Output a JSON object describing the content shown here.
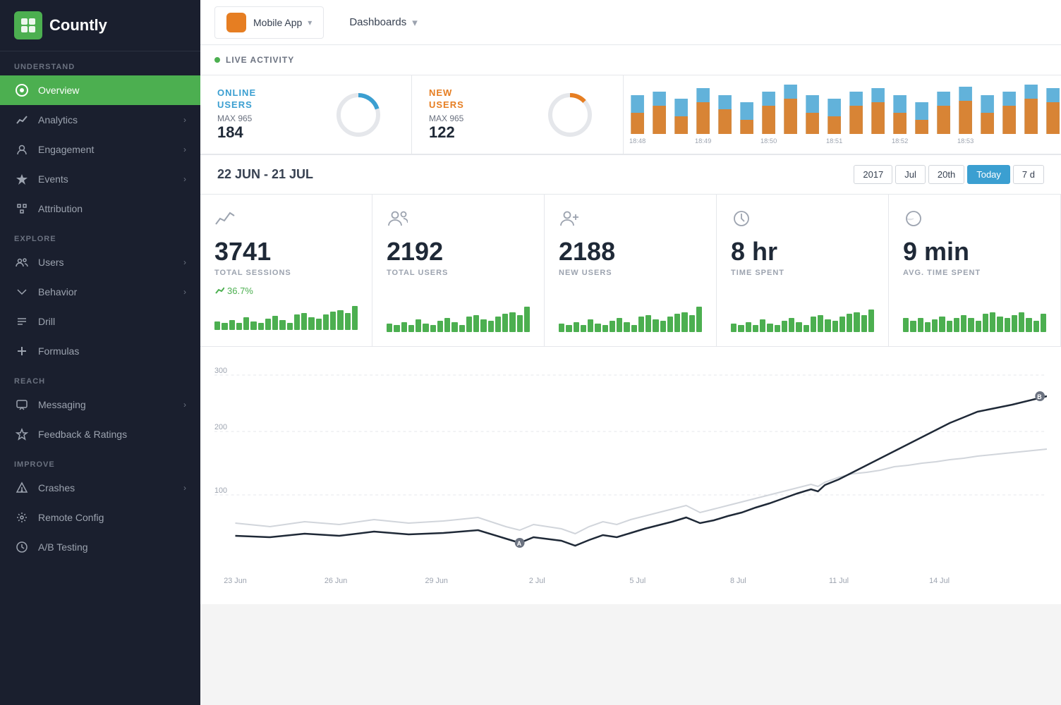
{
  "app": {
    "logo_text": "Countly",
    "logo_icon": "C"
  },
  "topbar": {
    "app_name": "Mobile App",
    "app_arrow": "▾",
    "dashboards_label": "Dashboards",
    "dashboards_arrow": "▾"
  },
  "sidebar": {
    "sections": [
      {
        "label": "UNDERSTAND",
        "items": [
          {
            "id": "overview",
            "label": "Overview",
            "icon": "⊙",
            "active": true,
            "has_arrow": false
          },
          {
            "id": "analytics",
            "label": "Analytics",
            "icon": "📈",
            "active": false,
            "has_arrow": true
          },
          {
            "id": "engagement",
            "label": "Engagement",
            "icon": "😊",
            "active": false,
            "has_arrow": true
          },
          {
            "id": "events",
            "label": "Events",
            "icon": "◆",
            "active": false,
            "has_arrow": true
          },
          {
            "id": "attribution",
            "label": "Attribution",
            "icon": "🏷",
            "active": false,
            "has_arrow": false
          }
        ]
      },
      {
        "label": "EXPLORE",
        "items": [
          {
            "id": "users",
            "label": "Users",
            "icon": "👥",
            "active": false,
            "has_arrow": true
          },
          {
            "id": "behavior",
            "label": "Behavior",
            "icon": "▼",
            "active": false,
            "has_arrow": true
          },
          {
            "id": "drill",
            "label": "Drill",
            "icon": "⚖",
            "active": false,
            "has_arrow": false
          },
          {
            "id": "formulas",
            "label": "Formulas",
            "icon": "➕",
            "active": false,
            "has_arrow": false
          }
        ]
      },
      {
        "label": "REACH",
        "items": [
          {
            "id": "messaging",
            "label": "Messaging",
            "icon": "💬",
            "active": false,
            "has_arrow": true
          },
          {
            "id": "feedback",
            "label": "Feedback & Ratings",
            "icon": "⭐",
            "active": false,
            "has_arrow": false
          }
        ]
      },
      {
        "label": "IMPROVE",
        "items": [
          {
            "id": "crashes",
            "label": "Crashes",
            "icon": "⚠",
            "active": false,
            "has_arrow": true
          },
          {
            "id": "remote-config",
            "label": "Remote Config",
            "icon": "⚙",
            "active": false,
            "has_arrow": false
          },
          {
            "id": "ab-testing",
            "label": "A/B Testing",
            "icon": "🔬",
            "active": false,
            "has_arrow": false
          }
        ]
      }
    ]
  },
  "live_activity": {
    "label": "LIVE ACTIVITY",
    "online_users": {
      "title_line1": "ONLINE",
      "title_line2": "USERS",
      "max_label": "MAX 965",
      "value": "184",
      "percent": 19
    },
    "new_users": {
      "title_line1": "NEW",
      "title_line2": "USERS",
      "max_label": "MAX 965",
      "value": "122",
      "percent": 13
    }
  },
  "date_range": {
    "label": "22 JUN - 21 JUL",
    "filters": [
      "2017",
      "Jul",
      "20th",
      "Today",
      "7 d"
    ]
  },
  "stats": [
    {
      "icon": "📈",
      "value": "3741",
      "label": "TOTAL SESSIONS",
      "trend": "36.7%",
      "bars": [
        3,
        2,
        3,
        2,
        4,
        3,
        2,
        3,
        4,
        3,
        2,
        4,
        5,
        4,
        3,
        4,
        5,
        6,
        5,
        7
      ]
    },
    {
      "icon": "👥",
      "value": "2192",
      "label": "TOTAL USERS",
      "trend": null,
      "bars": [
        3,
        2,
        3,
        2,
        4,
        3,
        2,
        3,
        4,
        3,
        2,
        4,
        5,
        4,
        3,
        4,
        5,
        6,
        5,
        8
      ]
    },
    {
      "icon": "👤+",
      "value": "2188",
      "label": "NEW USERS",
      "trend": null,
      "bars": [
        3,
        2,
        3,
        2,
        4,
        3,
        2,
        3,
        4,
        3,
        2,
        4,
        5,
        4,
        3,
        4,
        5,
        6,
        5,
        8
      ]
    },
    {
      "icon": "🕐",
      "value": "8 hr",
      "label": "TIME SPENT",
      "trend": null,
      "bars": [
        3,
        2,
        3,
        2,
        4,
        3,
        2,
        3,
        4,
        3,
        2,
        4,
        5,
        4,
        3,
        4,
        5,
        6,
        5,
        7
      ]
    },
    {
      "icon": "◑",
      "value": "9 min",
      "label": "AVG. TIME SPENT",
      "trend": null,
      "bars": [
        5,
        4,
        5,
        3,
        4,
        5,
        4,
        5,
        6,
        5,
        4,
        6,
        7,
        6,
        5,
        6,
        7,
        5,
        4,
        6
      ]
    }
  ],
  "chart": {
    "y_labels": [
      "300",
      "200",
      "100"
    ],
    "x_labels": [
      "23 Jun",
      "26 Jun",
      "29 Jun",
      "2 Jul",
      "5 Jul",
      "8 Jul",
      "11 Jul",
      "14 Jul"
    ]
  },
  "live_bar_times": [
    "18:48",
    "18:49",
    "18:50",
    "18:51",
    "18:52",
    "18:53"
  ]
}
